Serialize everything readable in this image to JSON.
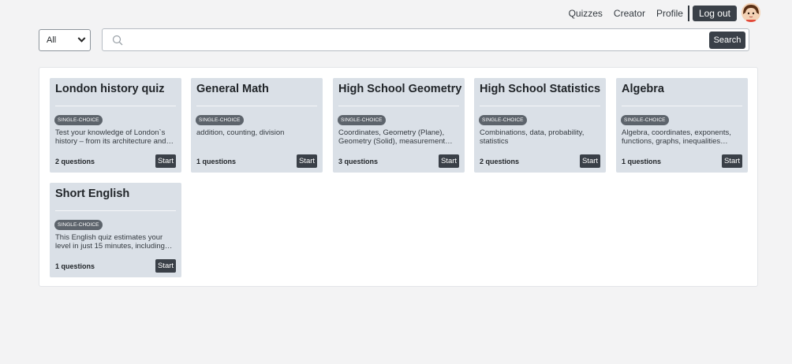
{
  "nav": {
    "quizzes": "Quizzes",
    "creator": "Creator",
    "profile": "Profile",
    "logout": "Log out"
  },
  "filter": {
    "selected": "All"
  },
  "search": {
    "button": "Search",
    "placeholder": ""
  },
  "cards": [
    {
      "title": "London history quiz",
      "badge": "SINGLE-CHOICE",
      "description": "Test your knowledge of London`s history – from its architecture and…",
      "count": "2 questions",
      "start": "Start"
    },
    {
      "title": "General Math",
      "badge": "SINGLE-CHOICE",
      "description": "addition, counting, division",
      "count": "1 questions",
      "start": "Start"
    },
    {
      "title": "High School Geometry",
      "badge": "SINGLE-CHOICE",
      "description": "Coordinates, Geometry (Plane), Geometry (Solid), measurement…",
      "count": "3 questions",
      "start": "Start"
    },
    {
      "title": "High School Statistics",
      "badge": "SINGLE-CHOICE",
      "description": "Combinations, data, probability, statistics",
      "count": "2 questions",
      "start": "Start"
    },
    {
      "title": "Algebra",
      "badge": "SINGLE-CHOICE",
      "description": "Algebra, coordinates, exponents, functions, graphs, inequalities…",
      "count": "1 questions",
      "start": "Start"
    },
    {
      "title": "Short English",
      "badge": "SINGLE-CHOICE",
      "description": "This English quiz estimates your level in just 15 minutes, including…",
      "count": "1 questions",
      "start": "Start"
    }
  ]
}
